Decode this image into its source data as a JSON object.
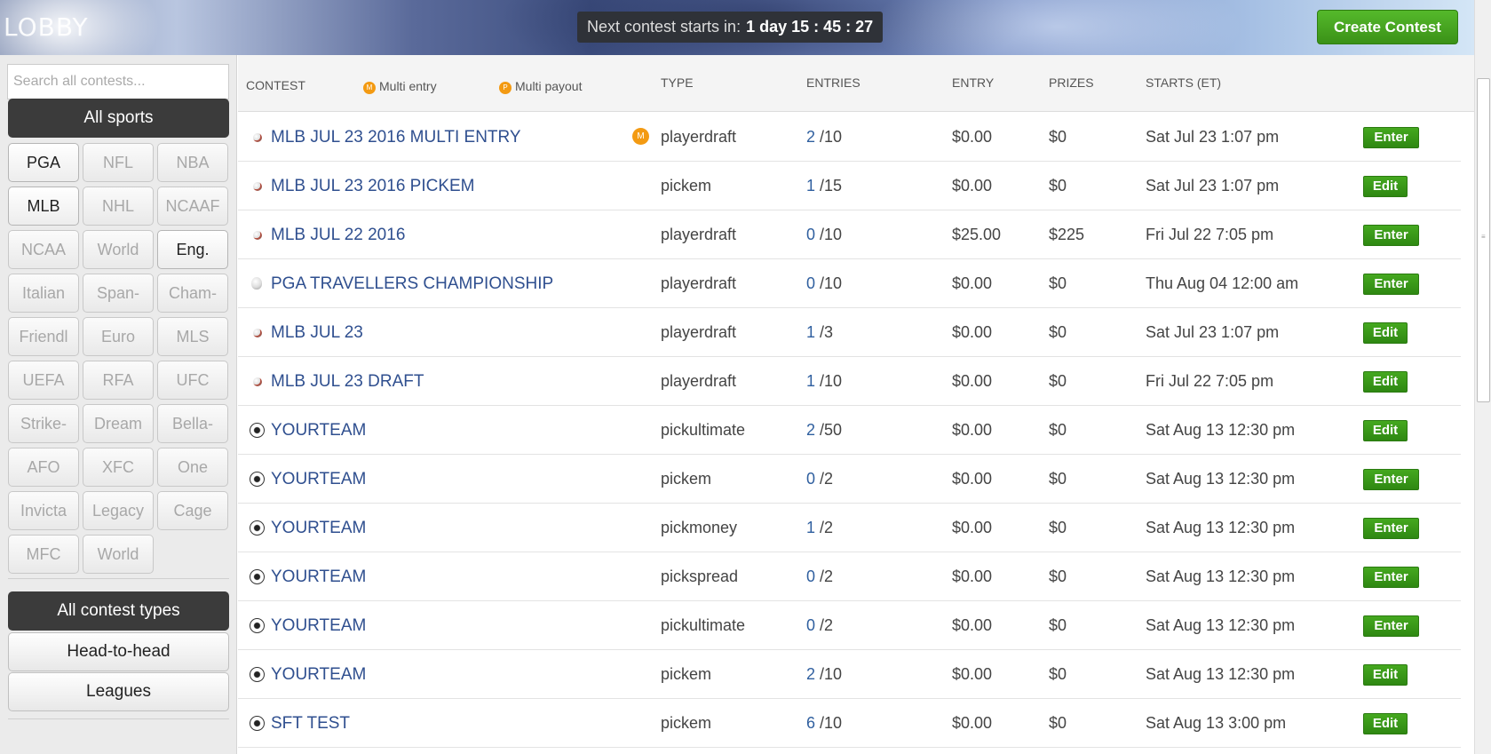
{
  "header": {
    "title": "LOBBY",
    "countdown_label": "Next contest starts in:",
    "countdown_value": "1 day 15 : 45 : 27",
    "create_button": "Create Contest"
  },
  "sidebar": {
    "search_placeholder": "Search all contests...",
    "all_sports": "All sports",
    "sports": [
      {
        "label": "PGA",
        "active": true
      },
      {
        "label": "NFL",
        "active": false
      },
      {
        "label": "NBA",
        "active": false
      },
      {
        "label": "MLB",
        "active": true
      },
      {
        "label": "NHL",
        "active": false
      },
      {
        "label": "NCAAF",
        "active": false
      },
      {
        "label": "NCAA",
        "active": false
      },
      {
        "label": "World",
        "active": false
      },
      {
        "label": "Eng.",
        "active": true
      },
      {
        "label": "Italian",
        "active": false
      },
      {
        "label": "Span-",
        "active": false
      },
      {
        "label": "Cham-",
        "active": false
      },
      {
        "label": "Friendl",
        "active": false
      },
      {
        "label": "Euro",
        "active": false
      },
      {
        "label": "MLS",
        "active": false
      },
      {
        "label": "UEFA",
        "active": false
      },
      {
        "label": "RFA",
        "active": false
      },
      {
        "label": "UFC",
        "active": false
      },
      {
        "label": "Strike-",
        "active": false
      },
      {
        "label": "Dream",
        "active": false
      },
      {
        "label": "Bella-",
        "active": false
      },
      {
        "label": "AFO",
        "active": false
      },
      {
        "label": "XFC",
        "active": false
      },
      {
        "label": "One",
        "active": false
      },
      {
        "label": "Invicta",
        "active": false
      },
      {
        "label": "Legacy",
        "active": false
      },
      {
        "label": "Cage",
        "active": false
      },
      {
        "label": "MFC",
        "active": false
      },
      {
        "label": "World",
        "active": false
      }
    ],
    "all_contest_types": "All contest types",
    "head_to_head": "Head-to-head",
    "leagues": "Leagues"
  },
  "table": {
    "headers": {
      "contest": "CONTEST",
      "multi_entry": "Multi entry",
      "multi_entry_badge": "M",
      "multi_payout": "Multi payout",
      "multi_payout_badge": "P",
      "type": "TYPE",
      "entries": "ENTRIES",
      "entry": "ENTRY",
      "prizes": "PRIZES",
      "starts": "STARTS (ET)"
    },
    "rows": [
      {
        "icon": "baseball-icon",
        "name": "MLB JUL 23 2016 MULTI ENTRY",
        "multi": "M",
        "type": "playerdraft",
        "entries": "2",
        "max": "/10",
        "entry": "$0.00",
        "prizes": "$0",
        "starts": "Sat Jul 23 1:07 pm",
        "action": "Enter"
      },
      {
        "icon": "baseball-icon",
        "name": "MLB JUL 23 2016 PICKEM",
        "multi": "",
        "type": "pickem",
        "entries": "1",
        "max": "/15",
        "entry": "$0.00",
        "prizes": "$0",
        "starts": "Sat Jul 23 1:07 pm",
        "action": "Edit"
      },
      {
        "icon": "baseball-icon",
        "name": "MLB JUL 22 2016",
        "multi": "",
        "type": "playerdraft",
        "entries": "0",
        "max": "/10",
        "entry": "$25.00",
        "prizes": "$225",
        "starts": "Fri Jul 22 7:05 pm",
        "action": "Enter"
      },
      {
        "icon": "golf-ball-icon",
        "name": "PGA TRAVELLERS CHAMPIONSHIP",
        "multi": "",
        "type": "playerdraft",
        "entries": "0",
        "max": "/10",
        "entry": "$0.00",
        "prizes": "$0",
        "starts": "Thu Aug 04 12:00 am",
        "action": "Enter"
      },
      {
        "icon": "baseball-icon",
        "name": "MLB JUL 23",
        "multi": "",
        "type": "playerdraft",
        "entries": "1",
        "max": "/3",
        "entry": "$0.00",
        "prizes": "$0",
        "starts": "Sat Jul 23 1:07 pm",
        "action": "Edit"
      },
      {
        "icon": "baseball-icon",
        "name": "MLB JUL 23 DRAFT",
        "multi": "",
        "type": "playerdraft",
        "entries": "1",
        "max": "/10",
        "entry": "$0.00",
        "prizes": "$0",
        "starts": "Fri Jul 22 7:05 pm",
        "action": "Edit"
      },
      {
        "icon": "soccer-ball-icon",
        "name": "YOURTEAM",
        "multi": "",
        "type": "pickultimate",
        "entries": "2",
        "max": "/50",
        "entry": "$0.00",
        "prizes": "$0",
        "starts": "Sat Aug 13 12:30 pm",
        "action": "Edit"
      },
      {
        "icon": "soccer-ball-icon",
        "name": "YOURTEAM",
        "multi": "",
        "type": "pickem",
        "entries": "0",
        "max": "/2",
        "entry": "$0.00",
        "prizes": "$0",
        "starts": "Sat Aug 13 12:30 pm",
        "action": "Enter"
      },
      {
        "icon": "soccer-ball-icon",
        "name": "YOURTEAM",
        "multi": "",
        "type": "pickmoney",
        "entries": "1",
        "max": "/2",
        "entry": "$0.00",
        "prizes": "$0",
        "starts": "Sat Aug 13 12:30 pm",
        "action": "Enter"
      },
      {
        "icon": "soccer-ball-icon",
        "name": "YOURTEAM",
        "multi": "",
        "type": "pickspread",
        "entries": "0",
        "max": "/2",
        "entry": "$0.00",
        "prizes": "$0",
        "starts": "Sat Aug 13 12:30 pm",
        "action": "Enter"
      },
      {
        "icon": "soccer-ball-icon",
        "name": "YOURTEAM",
        "multi": "",
        "type": "pickultimate",
        "entries": "0",
        "max": "/2",
        "entry": "$0.00",
        "prizes": "$0",
        "starts": "Sat Aug 13 12:30 pm",
        "action": "Enter"
      },
      {
        "icon": "soccer-ball-icon",
        "name": "YOURTEAM",
        "multi": "",
        "type": "pickem",
        "entries": "2",
        "max": "/10",
        "entry": "$0.00",
        "prizes": "$0",
        "starts": "Sat Aug 13 12:30 pm",
        "action": "Edit"
      },
      {
        "icon": "soccer-ball-icon",
        "name": "SFT TEST",
        "multi": "",
        "type": "pickem",
        "entries": "6",
        "max": "/10",
        "entry": "$0.00",
        "prizes": "$0",
        "starts": "Sat Aug 13 3:00 pm",
        "action": "Edit"
      }
    ]
  },
  "colors": {
    "accent_green": "#3a9117",
    "link_blue": "#2f4f8f",
    "badge_orange": "#f39a12",
    "sidebar_dark": "#3b3b3b"
  }
}
